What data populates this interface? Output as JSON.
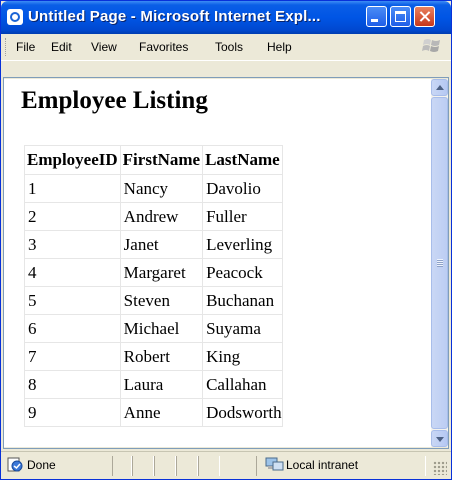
{
  "window": {
    "title": "Untitled Page - Microsoft Internet Expl..."
  },
  "menu": {
    "items": [
      "File",
      "Edit",
      "View",
      "Favorites",
      "Tools",
      "Help"
    ]
  },
  "page": {
    "heading": "Employee Listing",
    "table": {
      "columns": [
        "EmployeeID",
        "FirstName",
        "LastName"
      ],
      "rows": [
        [
          "1",
          "Nancy",
          "Davolio"
        ],
        [
          "2",
          "Andrew",
          "Fuller"
        ],
        [
          "3",
          "Janet",
          "Leverling"
        ],
        [
          "4",
          "Margaret",
          "Peacock"
        ],
        [
          "5",
          "Steven",
          "Buchanan"
        ],
        [
          "6",
          "Michael",
          "Suyama"
        ],
        [
          "7",
          "Robert",
          "King"
        ],
        [
          "8",
          "Laura",
          "Callahan"
        ],
        [
          "9",
          "Anne",
          "Dodsworth"
        ]
      ]
    }
  },
  "status": {
    "text": "Done",
    "zone": "Local intranet"
  },
  "icons": {
    "app": "internet-explorer-icon",
    "status": "page-done-icon",
    "zone": "intranet-icon",
    "logo": "windows-logo-icon"
  },
  "colors": {
    "titlebar": "#0055e5",
    "chrome": "#ece9d8",
    "close_button": "#c7371b"
  }
}
